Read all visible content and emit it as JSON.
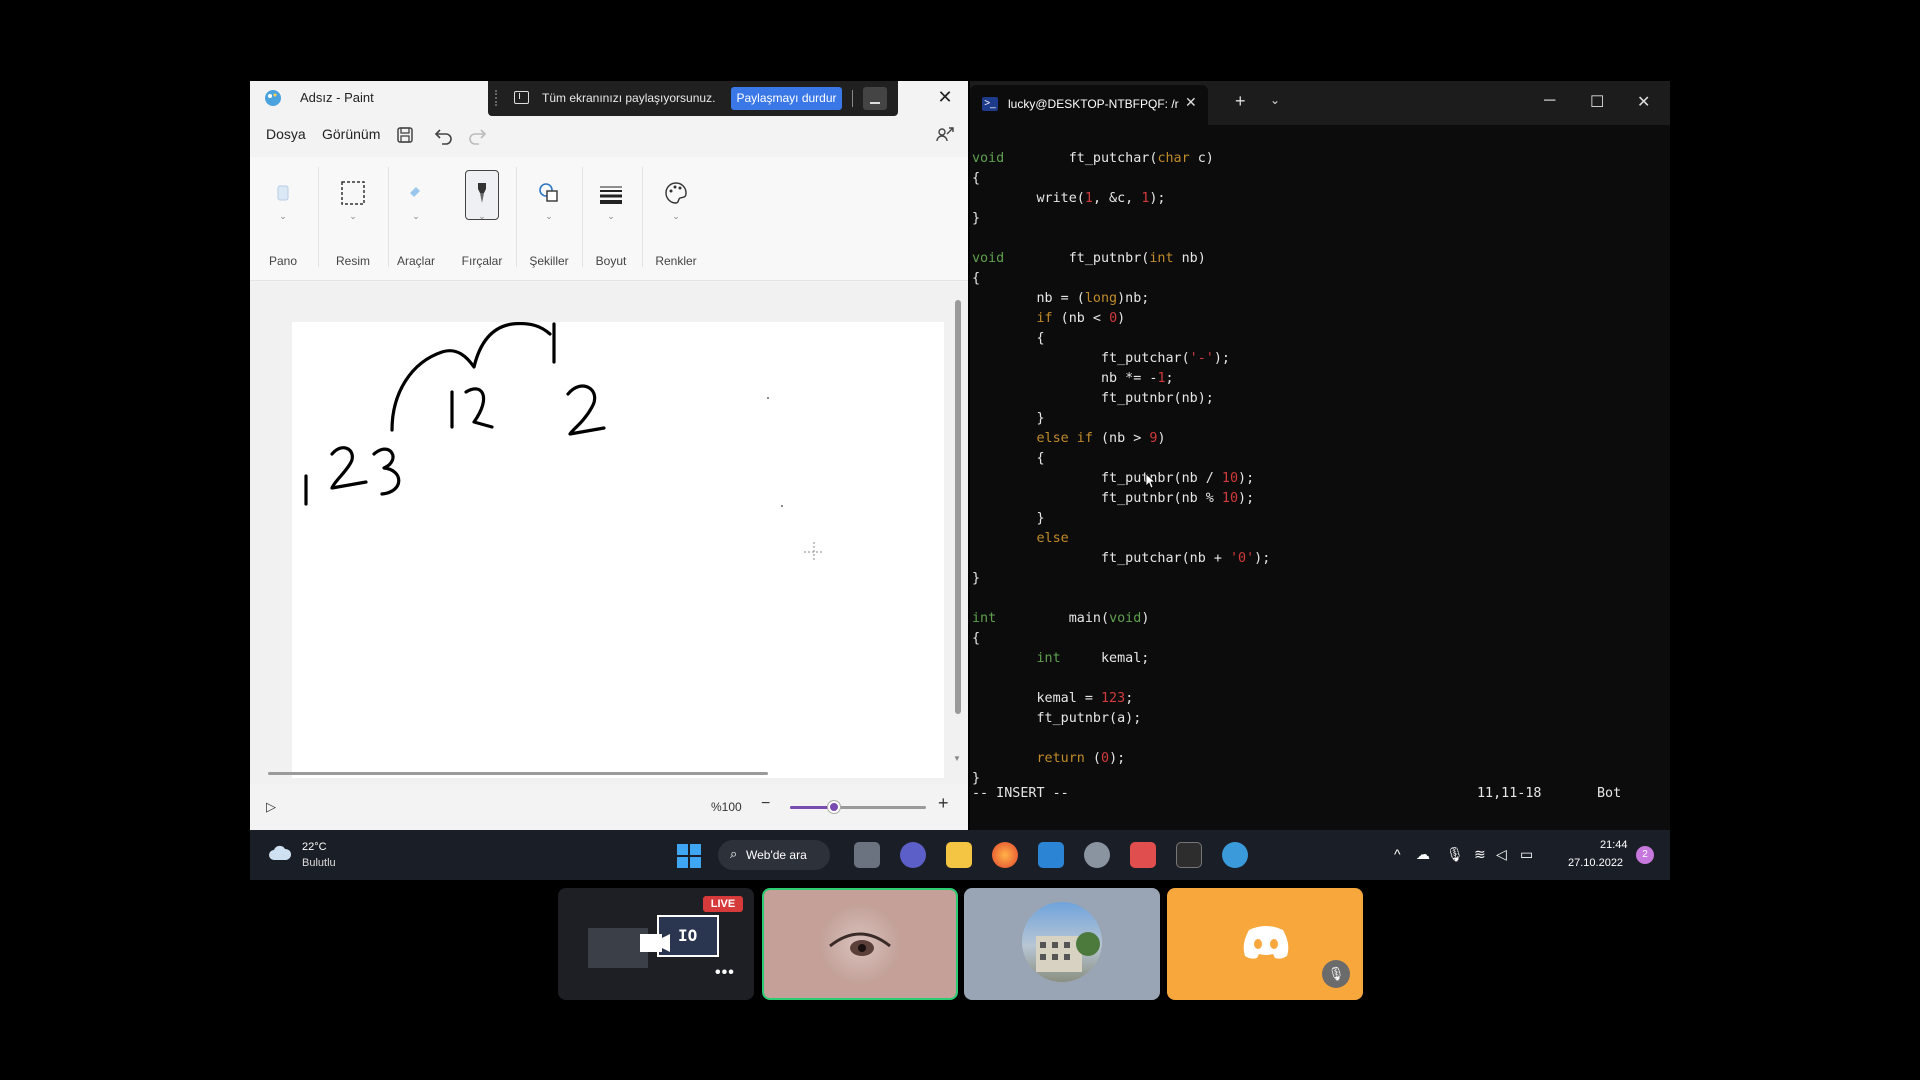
{
  "paint": {
    "title": "Adsız - Paint",
    "share_bar": {
      "message": "Tüm ekranınızı paylaşıyorsunuz.",
      "stop_label": "Paylaşmayı durdur"
    },
    "menu": {
      "file": "Dosya",
      "view": "Görünüm"
    },
    "ribbon": [
      {
        "label": "Pano",
        "icon": "clipboard-icon"
      },
      {
        "label": "Resim",
        "icon": "select-icon"
      },
      {
        "label": "Araçlar",
        "icon": "tools-icon"
      },
      {
        "label": "Fırçalar",
        "icon": "brush-icon"
      },
      {
        "label": "Şekiller",
        "icon": "shapes-icon"
      },
      {
        "label": "Boyut",
        "icon": "size-icon"
      },
      {
        "label": "Renkler",
        "icon": "palette-icon"
      }
    ],
    "status": {
      "zoom": "%100",
      "zoom_level": 0.32
    },
    "accent_color": "#7a4bb0"
  },
  "terminal": {
    "tab_title": "lucky@DESKTOP-NTBFPQF: /r",
    "mode": "-- INSERT --",
    "position": "11,11-18",
    "scroll": "Bot",
    "code": [
      [
        [
          "kw",
          "void"
        ],
        [
          "",
          "        ft_putchar("
        ],
        [
          "ty",
          "char"
        ],
        [
          "",
          " c)"
        ]
      ],
      [
        [
          "",
          "{"
        ]
      ],
      [
        [
          "",
          "        write("
        ],
        [
          "num",
          "1"
        ],
        [
          "",
          ", &c, "
        ],
        [
          "num",
          "1"
        ],
        [
          "",
          ");"
        ]
      ],
      [
        [
          "",
          "}"
        ]
      ],
      [
        [
          "",
          ""
        ]
      ],
      [
        [
          "kw",
          "void"
        ],
        [
          "",
          "        ft_putnbr("
        ],
        [
          "ty",
          "int"
        ],
        [
          "",
          " nb)"
        ]
      ],
      [
        [
          "",
          "{"
        ]
      ],
      [
        [
          "",
          "        nb = ("
        ],
        [
          "ty",
          "long"
        ],
        [
          "",
          ")nb;"
        ]
      ],
      [
        [
          "",
          "        "
        ],
        [
          "ty",
          "if"
        ],
        [
          "",
          " (nb < "
        ],
        [
          "num",
          "0"
        ],
        [
          "",
          ")"
        ]
      ],
      [
        [
          "",
          "        {"
        ]
      ],
      [
        [
          "",
          "                ft_putchar("
        ],
        [
          "str",
          "'-'"
        ],
        [
          "",
          ");"
        ]
      ],
      [
        [
          "",
          "                nb *= -"
        ],
        [
          "num",
          "1"
        ],
        [
          "",
          ";"
        ]
      ],
      [
        [
          "",
          "                ft_putnbr(nb);"
        ]
      ],
      [
        [
          "",
          "        }"
        ]
      ],
      [
        [
          "",
          "        "
        ],
        [
          "ty",
          "else if"
        ],
        [
          "",
          " (nb > "
        ],
        [
          "num",
          "9"
        ],
        [
          "",
          ")"
        ]
      ],
      [
        [
          "",
          "        {"
        ]
      ],
      [
        [
          "",
          "                ft_putnbr(nb / "
        ],
        [
          "num",
          "10"
        ],
        [
          "",
          ");"
        ]
      ],
      [
        [
          "",
          "                ft_putnbr(nb % "
        ],
        [
          "num",
          "10"
        ],
        [
          "",
          ");"
        ]
      ],
      [
        [
          "",
          "        }"
        ]
      ],
      [
        [
          "",
          "        "
        ],
        [
          "ty",
          "else"
        ]
      ],
      [
        [
          "",
          "                ft_putchar(nb + "
        ],
        [
          "str",
          "'0'"
        ],
        [
          "",
          ");"
        ]
      ],
      [
        [
          "",
          "}"
        ]
      ],
      [
        [
          "",
          ""
        ]
      ],
      [
        [
          "kw",
          "int"
        ],
        [
          "",
          "         main("
        ],
        [
          "kw",
          "void"
        ],
        [
          "",
          ")"
        ]
      ],
      [
        [
          "",
          "{"
        ]
      ],
      [
        [
          "",
          "        "
        ],
        [
          "kw",
          "int"
        ],
        [
          "",
          "     kemal;"
        ]
      ],
      [
        [
          "",
          ""
        ]
      ],
      [
        [
          "",
          "        kemal = "
        ],
        [
          "num",
          "123"
        ],
        [
          "",
          ";"
        ]
      ],
      [
        [
          "",
          "        ft_putnbr(a);"
        ]
      ],
      [
        [
          "",
          ""
        ]
      ],
      [
        [
          "",
          "        "
        ],
        [
          "ty",
          "return"
        ],
        [
          "",
          " ("
        ],
        [
          "num",
          "0"
        ],
        [
          "",
          ");"
        ]
      ],
      [
        [
          "",
          "}"
        ]
      ]
    ]
  },
  "taskbar": {
    "temperature": "22°C",
    "condition": "Bulutlu",
    "search": "Web'de ara",
    "time": "21:44",
    "date": "27.10.2022",
    "notifications": "2"
  },
  "tiles": {
    "live": "LIVE",
    "stream_label": "IO"
  }
}
